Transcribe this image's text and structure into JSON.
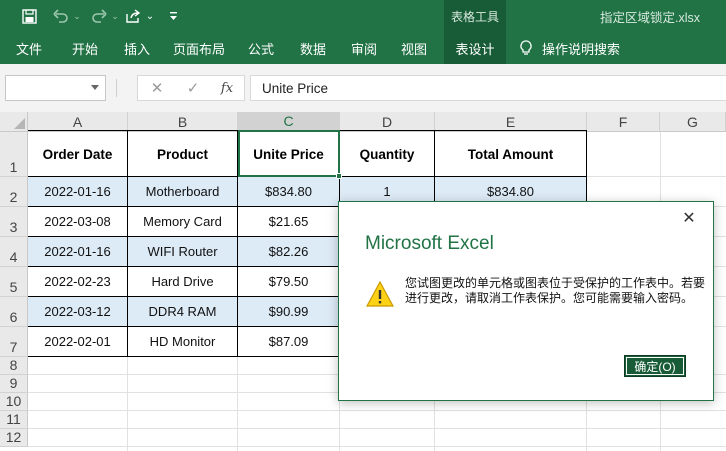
{
  "quick_access": {
    "save_icon": "save-icon",
    "undo_icon": "undo-icon",
    "redo_icon": "redo-icon",
    "share_icon": "share-icon",
    "customize_icon": "customize-qat-icon"
  },
  "title_bar": {
    "context_group": "表格工具",
    "document_title": "指定区域锁定.xlsx"
  },
  "ribbon": {
    "tabs": [
      {
        "label": "文件"
      },
      {
        "label": "开始"
      },
      {
        "label": "插入"
      },
      {
        "label": "页面布局"
      },
      {
        "label": "公式"
      },
      {
        "label": "数据"
      },
      {
        "label": "审阅"
      },
      {
        "label": "视图"
      },
      {
        "label": "表设计",
        "active": true
      }
    ],
    "tell_me": "操作说明搜索"
  },
  "formula_bar": {
    "name_box": "",
    "cancel_icon": "✕",
    "enter_icon": "✓",
    "fx_label": "fx",
    "content": "Unite Price"
  },
  "sheet": {
    "columns": [
      "A",
      "B",
      "C",
      "D",
      "E",
      "F",
      "G"
    ],
    "selected_column": "C",
    "rows": [
      "1",
      "2",
      "3",
      "4",
      "5",
      "6",
      "7",
      "8",
      "9",
      "10",
      "11",
      "12"
    ],
    "table": {
      "headers": [
        "Order Date",
        "Product",
        "Unite Price",
        "Quantity",
        "Total Amount"
      ],
      "rows": [
        [
          "2022-01-16",
          "Motherboard",
          "$834.80",
          "1",
          "$834.80"
        ],
        [
          "2022-03-08",
          "Memory Card",
          "$21.65",
          "",
          ""
        ],
        [
          "2022-01-16",
          "WIFI Router",
          "$82.26",
          "",
          ""
        ],
        [
          "2022-02-23",
          "Hard Drive",
          "$79.50",
          "",
          ""
        ],
        [
          "2022-03-12",
          "DDR4 RAM",
          "$90.99",
          "",
          ""
        ],
        [
          "2022-02-01",
          "HD Monitor",
          "$87.09",
          "",
          ""
        ]
      ],
      "band_color": "#ddebf7"
    }
  },
  "dialog": {
    "title": "Microsoft Excel",
    "message": "您试图更改的单元格或图表位于受保护的工作表中。若要进行更改，请取消工作表保护。您可能需要输入密码。",
    "ok_label": "确定(O)",
    "icon": "warning-icon"
  },
  "colors": {
    "excel_green": "#217346",
    "dark_green": "#185c37"
  }
}
